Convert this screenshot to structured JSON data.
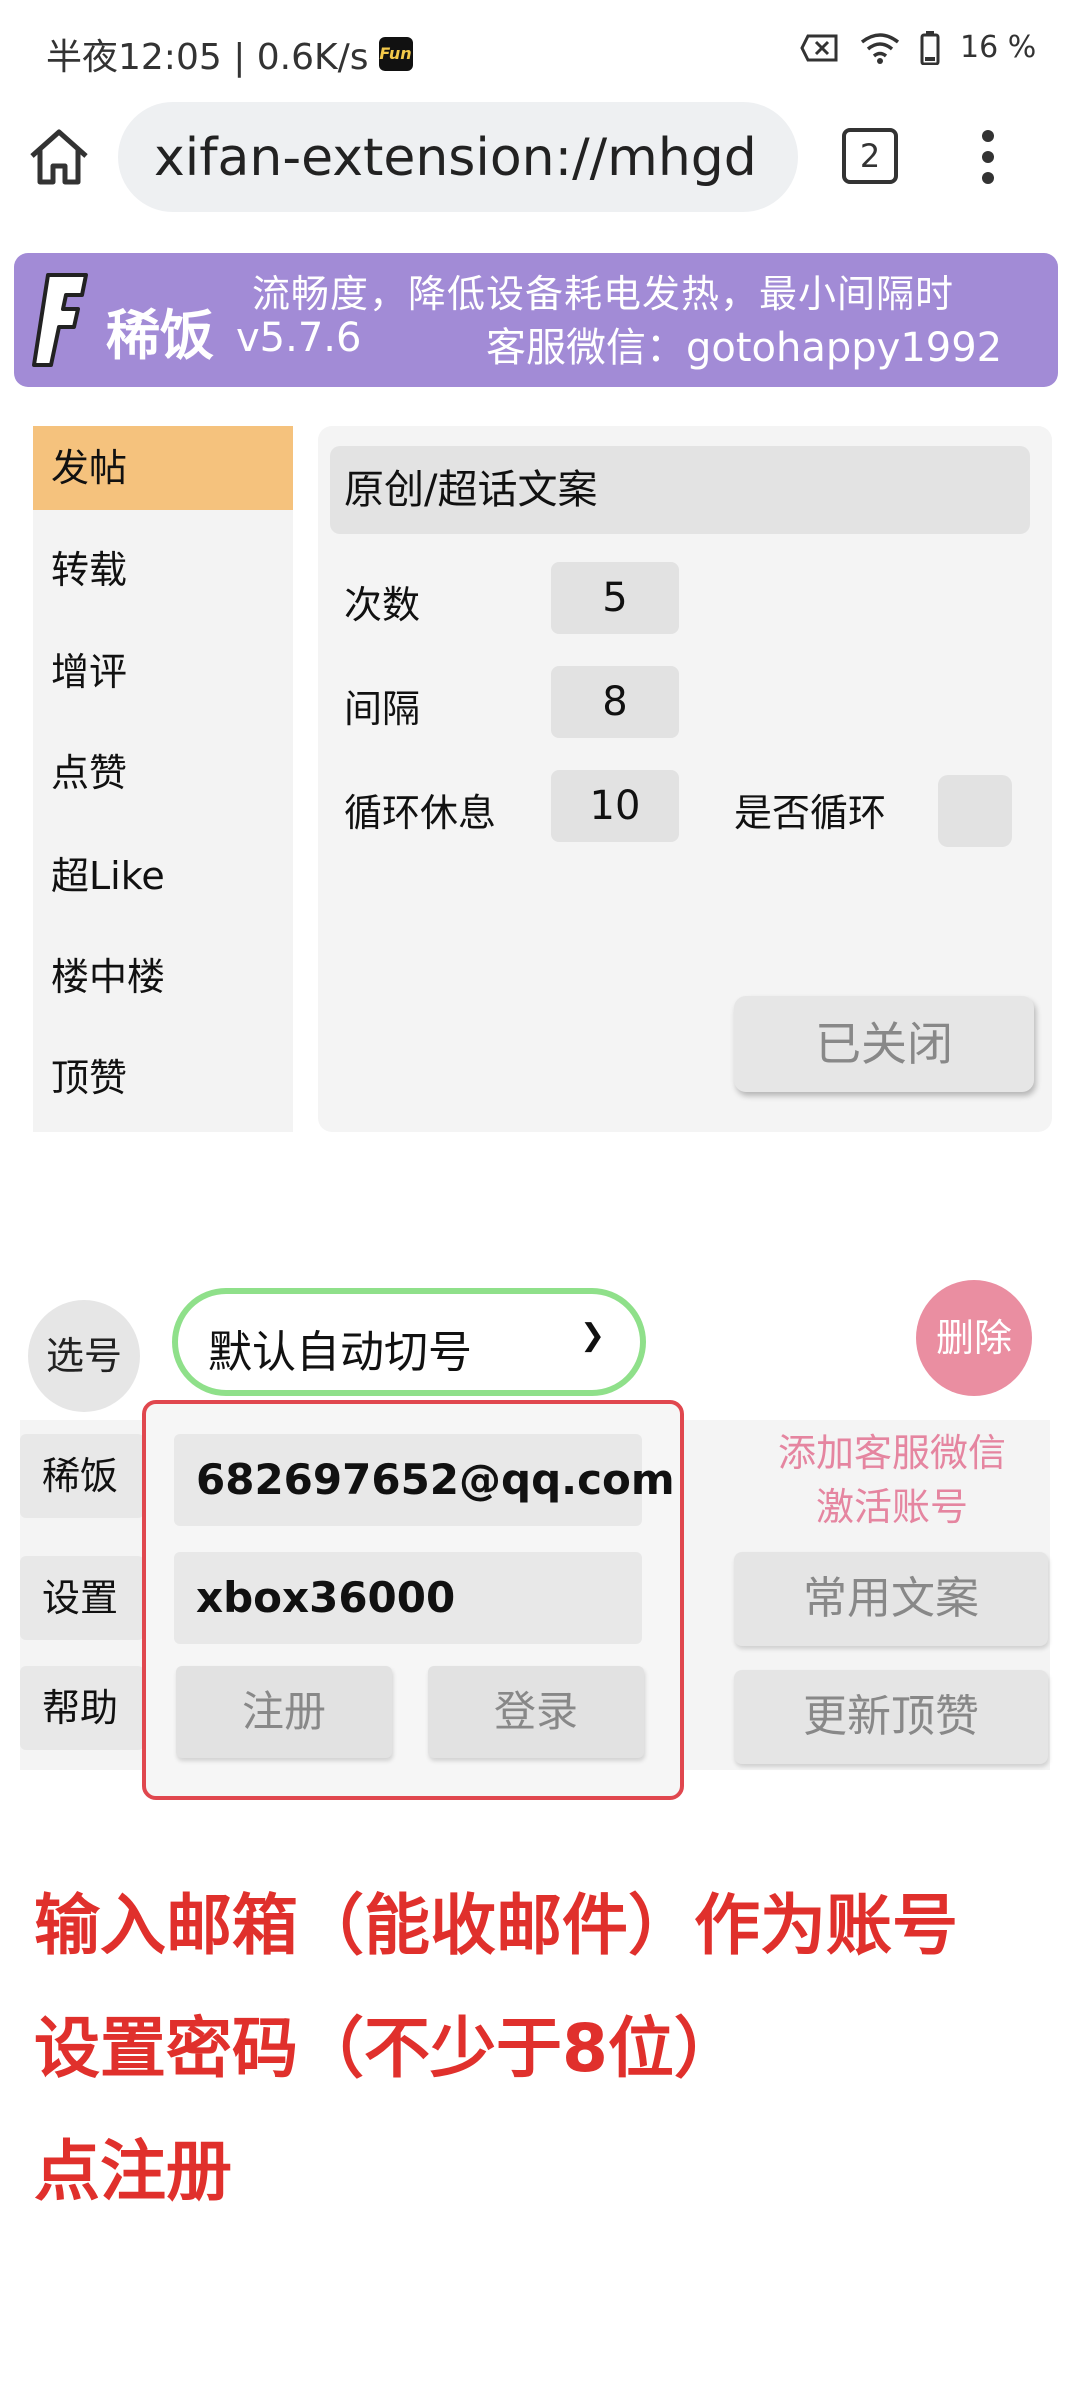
{
  "status_bar": {
    "time_speed": "半夜12:05 | 0.6K/s",
    "app_badge": "Fun",
    "battery": "16 %",
    "icons": [
      "battery-saver-icon",
      "wifi-icon",
      "battery-icon"
    ]
  },
  "browser": {
    "url": "xifan-extension://mhgd",
    "tab_count": "2",
    "icons": [
      "home-icon",
      "more-vert-icon"
    ]
  },
  "banner": {
    "logo": "稀饭",
    "marquee": "流畅度，降低设备耗电发热，最小间隔时",
    "version": "v5.7.6",
    "wechat": "客服微信：gotohappy1992",
    "bg_color": "#a28bd6"
  },
  "nav": {
    "items": [
      {
        "label": "发帖",
        "active": true
      },
      {
        "label": "转载",
        "active": false
      },
      {
        "label": "增评",
        "active": false
      },
      {
        "label": "点赞",
        "active": false
      },
      {
        "label": "超Like",
        "active": false
      },
      {
        "label": "楼中楼",
        "active": false
      },
      {
        "label": "顶赞",
        "active": false
      }
    ],
    "active_color": "#f5c27d"
  },
  "main": {
    "post_type": "原创/超话文案",
    "count_label": "次数",
    "count_value": "5",
    "interval_label": "间隔",
    "interval_value": "8",
    "rest_label": "循环休息",
    "rest_value": "10",
    "loop_label": "是否循环",
    "status_button": "已关闭"
  },
  "account": {
    "select_label": "选号",
    "selected": "默认自动切号",
    "delete_label": "删除",
    "tabs": [
      "稀饭",
      "设置",
      "帮助"
    ],
    "email_value": "682697652@qq.com",
    "password_value": "xbox36000",
    "register_label": "注册",
    "login_label": "登录",
    "note_line1": "添加客服微信",
    "note_line2": "激活账号",
    "common_text_label": "常用文案",
    "update_label": "更新顶赞",
    "highlight_color": "#e0474e"
  },
  "instructions": {
    "line1": "输入邮箱（能收邮件）作为账号",
    "line2": "设置密码（不少于8位）",
    "line3": "点注册",
    "color": "#e0302c"
  }
}
